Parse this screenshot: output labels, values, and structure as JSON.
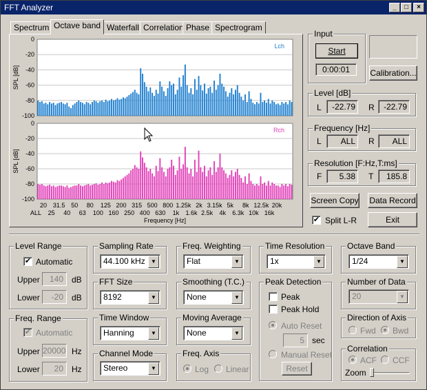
{
  "window": {
    "title": "FFT Analyzer",
    "min": "_",
    "max": "□",
    "close": "×"
  },
  "tabs": [
    "Spectrum",
    "Octave band",
    "Waterfall",
    "Correlation",
    "Phase",
    "Spectrogram"
  ],
  "active_tab": 1,
  "chart_data": [
    {
      "type": "bar",
      "channel_label": "Lch",
      "color": "#1e7fcf",
      "ylabel": "SPL [dB]",
      "ylim": [
        -100,
        0
      ],
      "yticks": [
        0,
        -20,
        -40,
        -60,
        -80,
        -100
      ],
      "values": [
        -80,
        -82,
        -81,
        -84,
        -83,
        -85,
        -82,
        -84,
        -83,
        -86,
        -84,
        -83,
        -82,
        -84,
        -85,
        -83,
        -88,
        -90,
        -86,
        -84,
        -82,
        -80,
        -82,
        -83,
        -85,
        -82,
        -83,
        -85,
        -82,
        -80,
        -81,
        -83,
        -81,
        -80,
        -82,
        -79,
        -81,
        -80,
        -78,
        -80,
        -79,
        -77,
        -79,
        -78,
        -76,
        -77,
        -75,
        -73,
        -71,
        -69,
        -66,
        -70,
        -72,
        -38,
        -45,
        -56,
        -62,
        -68,
        -63,
        -70,
        -74,
        -66,
        -71,
        -55,
        -62,
        -68,
        -74,
        -64,
        -55,
        -60,
        -58,
        -72,
        -66,
        -50,
        -62,
        -47,
        -33,
        -60,
        -70,
        -64,
        -72,
        -52,
        -66,
        -48,
        -60,
        -67,
        -58,
        -71,
        -64,
        -62,
        -70,
        -54,
        -66,
        -60,
        -45,
        -58,
        -62,
        -68,
        -75,
        -70,
        -64,
        -72,
        -66,
        -60,
        -70,
        -75,
        -80,
        -72,
        -82,
        -68,
        -78,
        -83,
        -85,
        -82,
        -84,
        -70,
        -82,
        -80,
        -83,
        -78,
        -84,
        -80,
        -82,
        -85,
        -84,
        -86,
        -82,
        -84,
        -82,
        -85,
        -80,
        -82
      ]
    },
    {
      "type": "bar",
      "channel_label": "Rch",
      "color": "#e040b8",
      "ylabel": "SPL [dB]",
      "ylim": [
        -100,
        0
      ],
      "yticks": [
        0,
        -20,
        -40,
        -60,
        -80,
        -100
      ],
      "xlabel": "Frequency [Hz]",
      "values": [
        -80,
        -81,
        -80,
        -82,
        -83,
        -82,
        -81,
        -83,
        -82,
        -84,
        -83,
        -82,
        -82,
        -83,
        -84,
        -82,
        -85,
        -84,
        -83,
        -82,
        -82,
        -80,
        -82,
        -83,
        -82,
        -81,
        -80,
        -82,
        -81,
        -80,
        -79,
        -81,
        -80,
        -78,
        -80,
        -78,
        -79,
        -78,
        -76,
        -77,
        -78,
        -75,
        -76,
        -74,
        -72,
        -70,
        -68,
        -66,
        -62,
        -60,
        -55,
        -58,
        -60,
        -37,
        -45,
        -52,
        -58,
        -63,
        -60,
        -66,
        -70,
        -56,
        -63,
        -46,
        -58,
        -64,
        -70,
        -60,
        -58,
        -48,
        -56,
        -68,
        -62,
        -44,
        -60,
        -54,
        -31,
        -58,
        -66,
        -60,
        -70,
        -48,
        -64,
        -36,
        -58,
        -64,
        -56,
        -70,
        -62,
        -58,
        -68,
        -50,
        -64,
        -58,
        -40,
        -58,
        -62,
        -66,
        -72,
        -68,
        -62,
        -70,
        -64,
        -60,
        -68,
        -72,
        -78,
        -70,
        -80,
        -66,
        -76,
        -80,
        -82,
        -80,
        -82,
        -70,
        -80,
        -78,
        -82,
        -76,
        -82,
        -78,
        -80,
        -82,
        -82,
        -84,
        -80,
        -82,
        -80,
        -83,
        -80,
        -81
      ]
    }
  ],
  "x_ticks_top": [
    "20",
    "31.5",
    "50",
    "80",
    "125",
    "200",
    "315",
    "500",
    "800",
    "1.25k",
    "2k",
    "3.15k",
    "5k",
    "8k",
    "12.5k",
    "20k"
  ],
  "x_ticks_bottom": [
    "ALL",
    "25",
    "40",
    "63",
    "100",
    "160",
    "250",
    "400",
    "630",
    "1k",
    "1.6k",
    "2.5k",
    "4k",
    "6.3k",
    "10k",
    "16k"
  ],
  "input": {
    "title": "Input",
    "start": "Start",
    "time": "0:00:01",
    "calibration": "Calibration..."
  },
  "level": {
    "title": "Level [dB]",
    "l_label": "L",
    "l_value": "-22.79",
    "r_label": "R",
    "r_value": "-22.79"
  },
  "frequency": {
    "title": "Frequency [Hz]",
    "l_label": "L",
    "l_value": "ALL",
    "r_label": "R",
    "r_value": "ALL"
  },
  "resolution": {
    "title": "Resolution [F:Hz,T:ms]",
    "f_label": "F",
    "f_value": "5.38",
    "t_label": "T",
    "t_value": "185.8"
  },
  "actions": {
    "screen_copy": "Screen Copy",
    "data_record": "Data Record",
    "split": "Split L-R",
    "exit": "Exit"
  },
  "level_range": {
    "title": "Level Range",
    "automatic": "Automatic",
    "upper_label": "Upper",
    "upper_value": "140",
    "upper_unit": "dB",
    "lower_label": "Lower",
    "lower_value": "-20",
    "lower_unit": "dB"
  },
  "freq_range": {
    "title": "Freq. Range",
    "automatic": "Automatic",
    "upper_label": "Upper",
    "upper_value": "20000",
    "upper_unit": "Hz",
    "lower_label": "Lower",
    "lower_value": "20",
    "lower_unit": "Hz"
  },
  "sampling_rate": {
    "title": "Sampling Rate",
    "value": "44.100 kHz"
  },
  "fft_size": {
    "title": "FFT Size",
    "value": "8192"
  },
  "time_window": {
    "title": "Time Window",
    "value": "Hanning"
  },
  "channel_mode": {
    "title": "Channel Mode",
    "value": "Stereo"
  },
  "freq_weighting": {
    "title": "Freq. Weighting",
    "value": "Flat"
  },
  "smoothing": {
    "title": "Smoothing (T.C.)",
    "value": "None"
  },
  "moving_average": {
    "title": "Moving Average",
    "value": "None"
  },
  "freq_axis": {
    "title": "Freq. Axis",
    "log": "Log",
    "linear": "Linear"
  },
  "time_resolution": {
    "title": "Time Resolution",
    "value": "1x"
  },
  "peak_detection": {
    "title": "Peak Detection",
    "peak": "Peak",
    "peak_hold": "Peak Hold",
    "auto_reset": "Auto Reset",
    "sec_value": "5",
    "sec_unit": "sec",
    "manual_reset": "Manual Reset",
    "reset": "Reset"
  },
  "octave_band": {
    "title": "Octave Band",
    "value": "1/24"
  },
  "number_of_data": {
    "title": "Number of Data",
    "value": "20"
  },
  "direction": {
    "title": "Direction of Axis",
    "fwd": "Fwd",
    "bwd": "Bwd"
  },
  "correlation": {
    "title": "Correlation",
    "acf": "ACF",
    "ccf": "CCF",
    "zoom": "Zoom"
  }
}
